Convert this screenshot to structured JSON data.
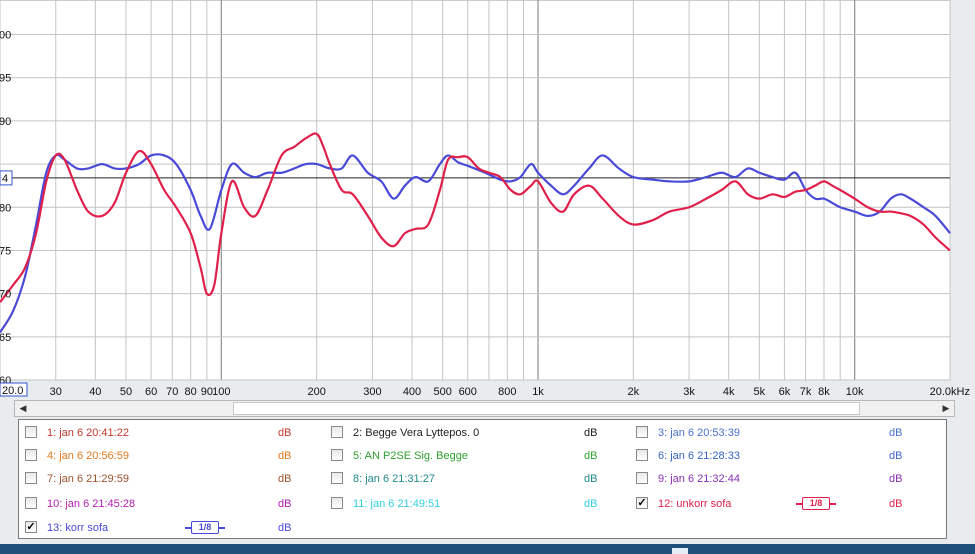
{
  "chart_data": {
    "type": "line",
    "x_scale": "log",
    "xlim": [
      20,
      20000
    ],
    "ylim": [
      60,
      104
    ],
    "grid": true,
    "x_ticks": [
      {
        "v": 20,
        "label": "20.0"
      },
      {
        "v": 30,
        "label": "30"
      },
      {
        "v": 40,
        "label": "40"
      },
      {
        "v": 50,
        "label": "50"
      },
      {
        "v": 60,
        "label": "60"
      },
      {
        "v": 70,
        "label": "70"
      },
      {
        "v": 80,
        "label": "80"
      },
      {
        "v": 90,
        "label": "90"
      },
      {
        "v": 100,
        "label": "100"
      },
      {
        "v": 200,
        "label": "200"
      },
      {
        "v": 300,
        "label": "300"
      },
      {
        "v": 400,
        "label": "400"
      },
      {
        "v": 500,
        "label": "500"
      },
      {
        "v": 600,
        "label": "600"
      },
      {
        "v": 800,
        "label": "800"
      },
      {
        "v": 1000,
        "label": "1k"
      },
      {
        "v": 2000,
        "label": "2k"
      },
      {
        "v": 3000,
        "label": "3k"
      },
      {
        "v": 4000,
        "label": "4k"
      },
      {
        "v": 5000,
        "label": "5k"
      },
      {
        "v": 6000,
        "label": "6k"
      },
      {
        "v": 7000,
        "label": "7k"
      },
      {
        "v": 8000,
        "label": "8k"
      },
      {
        "v": 10000,
        "label": "10k"
      },
      {
        "v": 20000,
        "label": "20.0kHz"
      }
    ],
    "y_ticks": [
      {
        "v": 100,
        "label": "00"
      },
      {
        "v": 95,
        "label": "95"
      },
      {
        "v": 90,
        "label": "90"
      },
      {
        "v": 85,
        "label": "85"
      },
      {
        "v": 80,
        "label": "80"
      },
      {
        "v": 75,
        "label": "75"
      },
      {
        "v": 70,
        "label": "70"
      },
      {
        "v": 65,
        "label": "65"
      },
      {
        "v": 60,
        "label": "60"
      }
    ],
    "reference_line": {
      "y": 83.4,
      "label": "4"
    },
    "x_range_label": "20.0",
    "series": [
      {
        "name": "13: korr sofa",
        "color": "#4a4ad8",
        "x": [
          20,
          22,
          24,
          26,
          28,
          30,
          32,
          35,
          38,
          42,
          46,
          50,
          55,
          60,
          66,
          72,
          80,
          86,
          92,
          100,
          108,
          118,
          128,
          140,
          155,
          170,
          185,
          200,
          220,
          240,
          260,
          290,
          320,
          350,
          380,
          410,
          450,
          490,
          520,
          560,
          600,
          650,
          700,
          760,
          820,
          880,
          950,
          1000,
          1100,
          1200,
          1300,
          1450,
          1600,
          1800,
          2000,
          2300,
          2600,
          3000,
          3400,
          3800,
          4200,
          4600,
          5000,
          5500,
          6000,
          6500,
          7000,
          7500,
          8000,
          8500,
          9000,
          10000,
          11000,
          12000,
          13000,
          14000,
          15000,
          16500,
          18000,
          20000
        ],
        "y": [
          65.5,
          68,
          72,
          78,
          84,
          86,
          85.5,
          84.5,
          84.5,
          85,
          84.5,
          84.5,
          85,
          86,
          86,
          85,
          82,
          79,
          77.5,
          82,
          85,
          84,
          83.5,
          84,
          84,
          84.5,
          85,
          85,
          84.5,
          84.5,
          86,
          84,
          83,
          81,
          82.5,
          83.5,
          83,
          85,
          86,
          85.2,
          84.8,
          84.3,
          83.8,
          83.2,
          83,
          83.5,
          85,
          84,
          82.5,
          81.5,
          82.5,
          84.5,
          86,
          84.5,
          83.5,
          83.2,
          83,
          83,
          83.5,
          84,
          83.5,
          84.5,
          84,
          83.5,
          83.2,
          84,
          82,
          81,
          81,
          80.5,
          80,
          79.5,
          79,
          79.5,
          81,
          81.5,
          81,
          80,
          79,
          77
        ]
      },
      {
        "name": "12: unkorr sofa",
        "color": "#e0204a",
        "x": [
          20,
          22,
          24,
          26,
          28,
          30,
          32,
          35,
          38,
          42,
          46,
          50,
          55,
          60,
          66,
          72,
          80,
          86,
          90,
          95,
          100,
          108,
          118,
          128,
          140,
          155,
          170,
          185,
          200,
          210,
          220,
          240,
          260,
          290,
          320,
          350,
          380,
          410,
          450,
          490,
          520,
          560,
          600,
          650,
          700,
          760,
          820,
          880,
          950,
          1000,
          1100,
          1200,
          1300,
          1450,
          1600,
          1800,
          2000,
          2300,
          2600,
          3000,
          3400,
          3800,
          4200,
          4600,
          5000,
          5500,
          6000,
          6500,
          7000,
          7500,
          8000,
          8500,
          9000,
          10000,
          11000,
          12000,
          13000,
          14000,
          15000,
          16500,
          18000,
          20000
        ],
        "y": [
          69,
          71,
          73,
          77,
          83,
          86,
          85.5,
          82,
          79.5,
          79,
          80.5,
          84,
          86.5,
          85,
          82,
          80,
          77,
          73,
          70,
          71,
          77,
          83,
          80,
          79,
          82,
          86,
          87,
          88,
          88.5,
          87,
          85,
          82,
          81.5,
          79,
          76.5,
          75.5,
          77,
          77.5,
          78,
          82,
          85.5,
          85.8,
          85.8,
          84.5,
          84,
          83.5,
          82,
          81.5,
          82.5,
          83,
          80.5,
          79.5,
          81.5,
          82.5,
          81,
          79,
          78,
          78.5,
          79.5,
          80,
          81,
          82,
          83,
          81.5,
          81,
          81.5,
          81.2,
          81.8,
          82,
          82.5,
          83,
          82.5,
          82,
          81,
          80,
          79.5,
          79.5,
          79.3,
          79,
          78,
          76.5,
          75
        ]
      }
    ]
  },
  "scrollbar": {
    "left_arrow": "◀",
    "right_arrow": "▶"
  },
  "legend": {
    "items": [
      {
        "label": "1: jan 6 20:41:22",
        "color": "#c0392b",
        "checked": false,
        "db": "dB"
      },
      {
        "label": "2: Begge Vera Lyttepos. 0",
        "color": "#222222",
        "checked": false,
        "db": "dB"
      },
      {
        "label": "3: jan 6 20:53:39",
        "color": "#4a6fd0",
        "checked": false,
        "db": "dB"
      },
      {
        "label": "4: jan 6 20:56:59",
        "color": "#e07820",
        "checked": false,
        "db": "dB"
      },
      {
        "label": "5: AN P2SE Sig. Begge",
        "color": "#2fa02f",
        "checked": false,
        "db": "dB"
      },
      {
        "label": "6: jan 6 21:28:33",
        "color": "#3a64c8",
        "checked": false,
        "db": "dB"
      },
      {
        "label": "7: jan 6 21:29:59",
        "color": "#a0522d",
        "checked": false,
        "db": "dB"
      },
      {
        "label": "8: jan 6 21:31:27",
        "color": "#208a8a",
        "checked": false,
        "db": "dB"
      },
      {
        "label": "9: jan 6 21:32:44",
        "color": "#8a2fb8",
        "checked": false,
        "db": "dB"
      },
      {
        "label": "10: jan 6 21:45:28",
        "color": "#b020b0",
        "checked": false,
        "db": "dB"
      },
      {
        "label": "11: jan 6 21:49:51",
        "color": "#30d0e0",
        "checked": false,
        "db": "dB"
      },
      {
        "label": "12: unkorr sofa",
        "color": "#e0204a",
        "checked": true,
        "db": "dB",
        "badge": "1/8"
      },
      {
        "label": "13: korr sofa",
        "color": "#4a4ad8",
        "checked": true,
        "db": "dB",
        "badge": "1/8"
      }
    ],
    "check_mark": "✓"
  }
}
